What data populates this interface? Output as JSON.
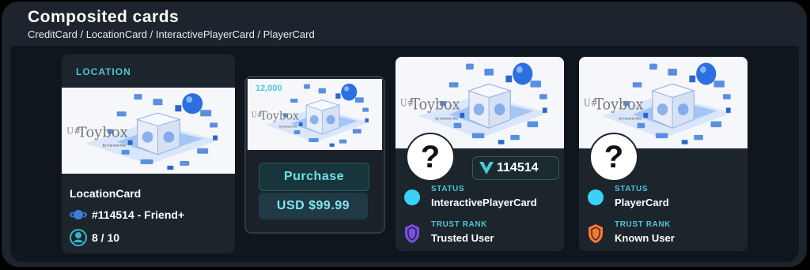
{
  "header": {
    "title": "Composited cards",
    "subtitle": "CreditCard / LocationCard / InteractivePlayerCard / PlayerCard"
  },
  "image": {
    "logo_text": "U#Toybox",
    "logo_sub": "by Kuroné Kito"
  },
  "location_card": {
    "label": "LOCATION",
    "title": "LocationCard",
    "instance": "#114514 - Friend+",
    "occupancy": "8 / 10"
  },
  "credit_card": {
    "amount": "12,000",
    "purchase_label": "Purchase",
    "price": "USD $99.99"
  },
  "interactive_player_card": {
    "id_label": "114514",
    "status_caption": "STATUS",
    "status_value": "InteractivePlayerCard",
    "rank_caption": "TRUST RANK",
    "rank_value": "Trusted User",
    "rank_color": "#7a4fe0"
  },
  "player_card": {
    "status_caption": "STATUS",
    "status_value": "PlayerCard",
    "rank_caption": "TRUST RANK",
    "rank_value": "Known User",
    "rank_color": "#f07a3a"
  },
  "colors": {
    "accent": "#4ec7d8",
    "status_dot": "#3ad2f8"
  }
}
